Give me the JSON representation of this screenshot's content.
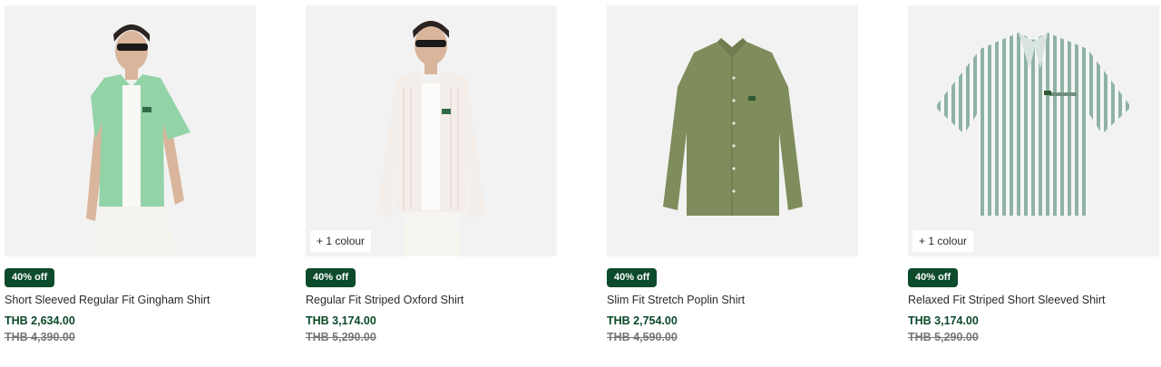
{
  "products": [
    {
      "name": "Short Sleeved Regular Fit Gingham Shirt",
      "badge": "40% off",
      "price": "THB 2,634.00",
      "old_price": "THB 4,390.00",
      "colour_chip": "",
      "shirt_color": "#93d3a8"
    },
    {
      "name": "Regular Fit Striped Oxford Shirt",
      "badge": "40% off",
      "price": "THB 3,174.00",
      "old_price": "THB 5,290.00",
      "colour_chip": "+ 1 colour",
      "shirt_color": "#f4eeea"
    },
    {
      "name": "Slim Fit Stretch Poplin Shirt",
      "badge": "40% off",
      "price": "THB 2,754.00",
      "old_price": "THB 4,590.00",
      "colour_chip": "",
      "shirt_color": "#7f8c5c"
    },
    {
      "name": "Relaxed Fit Striped Short Sleeved Shirt",
      "badge": "40% off",
      "price": "THB 3,174.00",
      "old_price": "THB 5,290.00",
      "colour_chip": "+ 1 colour",
      "shirt_color": "#8fb2a4"
    }
  ]
}
